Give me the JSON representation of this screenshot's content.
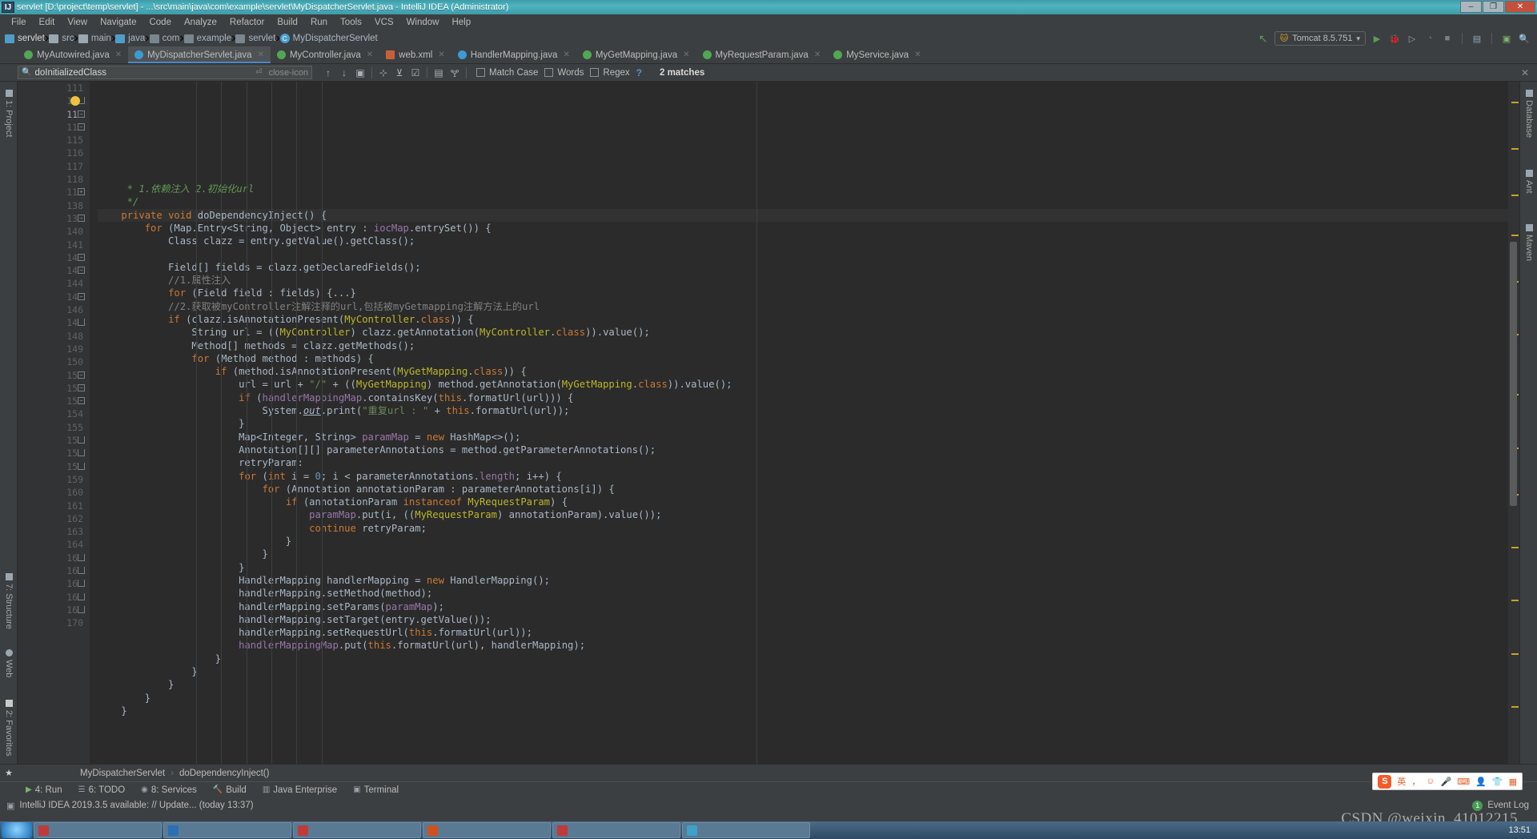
{
  "window": {
    "title": "servlet [D:\\project\\temp\\servlet] - ...\\src\\main\\java\\com\\example\\servlet\\MyDispatcherServlet.java - IntelliJ IDEA (Administrator)",
    "icon": "intellij-idea-icon",
    "minimize": "–",
    "maximize": "❐",
    "close": "✕"
  },
  "menubar": {
    "items": [
      "File",
      "Edit",
      "View",
      "Navigate",
      "Code",
      "Analyze",
      "Refactor",
      "Build",
      "Run",
      "Tools",
      "VCS",
      "Window",
      "Help"
    ]
  },
  "breadcrumb": {
    "items": [
      {
        "label": "servlet",
        "icon": "module-icon"
      },
      {
        "label": "src",
        "icon": "folder-icon"
      },
      {
        "label": "main",
        "icon": "folder-icon"
      },
      {
        "label": "java",
        "icon": "source-folder-icon"
      },
      {
        "label": "com",
        "icon": "package-icon"
      },
      {
        "label": "example",
        "icon": "package-icon"
      },
      {
        "label": "servlet",
        "icon": "package-icon"
      },
      {
        "label": "MyDispatcherServlet",
        "icon": "class-icon"
      }
    ],
    "separator": "›"
  },
  "navbar_right": {
    "back_icon": "arrow-up-left-icon",
    "run_config": {
      "label": "Tomcat 8.5.751",
      "icon": "tomcat-icon",
      "chevron": "▾"
    },
    "actions": [
      {
        "name": "run-button",
        "glyph": "▶",
        "color": "#5a9e54"
      },
      {
        "name": "debug-button",
        "glyph": "🐞",
        "color": "#5a9e54"
      },
      {
        "name": "run-with-coverage-button",
        "glyph": "▣",
        "color": "#9aa0a6"
      },
      {
        "name": "profile-button",
        "glyph": "◔",
        "color": "#6d7276"
      },
      {
        "name": "stop-button",
        "glyph": "■",
        "color": "#7c8185"
      },
      {
        "name": "project-structure-button",
        "glyph": "▤",
        "color": "#9aa0a6"
      },
      {
        "name": "terminal-button",
        "glyph": "▣",
        "color": "#9aa0a6"
      },
      {
        "name": "search-everywhere-button",
        "glyph": "🔍",
        "color": "#9aa0a6"
      }
    ]
  },
  "tabs": [
    {
      "label": "MyAutowired.java",
      "icon": "annotation-class-icon",
      "active": false,
      "close": "✕"
    },
    {
      "label": "MyDispatcherServlet.java",
      "icon": "class-icon",
      "active": true,
      "close": "✕"
    },
    {
      "label": "MyController.java",
      "icon": "annotation-class-icon",
      "active": false,
      "close": "✕"
    },
    {
      "label": "web.xml",
      "icon": "xml-file-icon",
      "active": false,
      "close": "✕"
    },
    {
      "label": "HandlerMapping.java",
      "icon": "class-icon",
      "active": false,
      "close": "✕"
    },
    {
      "label": "MyGetMapping.java",
      "icon": "annotation-class-icon",
      "active": false,
      "close": "✕"
    },
    {
      "label": "MyRequestParam.java",
      "icon": "annotation-class-icon",
      "active": false,
      "close": "✕"
    },
    {
      "label": "MyService.java",
      "icon": "annotation-class-icon",
      "active": false,
      "close": "✕"
    }
  ],
  "findbar": {
    "search_value": "doInitializedClass",
    "search_icon": "search-icon",
    "history_icon": "chevron-down-icon",
    "newline_icon": "multiline-icon",
    "clear_icon": "close-icon",
    "prev_icon": "↑",
    "next_icon": "↓",
    "select_all_icon": "▣",
    "add_cursor_icon": "+",
    "remove_cursor_icon": "−",
    "select_occurrences_icon": "☑",
    "in_selection_icon": "▤",
    "filter_icon": "▼",
    "match_case": {
      "label": "Match Case",
      "checked": false
    },
    "words": {
      "label": "Words",
      "checked": false
    },
    "regex": {
      "label": "Regex",
      "checked": false
    },
    "help": "?",
    "result": "2 matches",
    "close": "✕"
  },
  "left_tool_buttons": [
    {
      "label": "1: Project",
      "icon": "project-icon"
    },
    {
      "label": "7: Structure",
      "icon": "structure-icon"
    },
    {
      "label": "Web",
      "icon": "web-icon"
    },
    {
      "label": "2: Favorites",
      "icon": "favorites-star-icon"
    }
  ],
  "right_tool_buttons": [
    {
      "label": "Database",
      "icon": "database-icon"
    },
    {
      "label": "Ant",
      "icon": "ant-icon"
    },
    {
      "label": "Maven",
      "icon": "maven-icon"
    }
  ],
  "editor": {
    "first_line": 111,
    "caret_line": 113,
    "lines": [
      {
        "n": "111",
        "text": "     * 1.依赖注入 2.初始化url",
        "fold": "",
        "kind": "comment"
      },
      {
        "n": "112",
        "text": "     */",
        "fold": "end",
        "bulb": true,
        "kind": "comment"
      },
      {
        "n": "113",
        "text": "    private void doDependencyInject() {",
        "fold": "start",
        "current": true
      },
      {
        "n": "114",
        "text": "        for (Map.Entry<String, Object> entry : iocMap.entrySet()) {",
        "fold": "start"
      },
      {
        "n": "115",
        "text": "            Class clazz = entry.getValue().getClass();",
        "fold": ""
      },
      {
        "n": "116",
        "text": "",
        "fold": ""
      },
      {
        "n": "117",
        "text": "            Field[] fields = clazz.getDeclaredFields();",
        "fold": ""
      },
      {
        "n": "118",
        "text": "            //1.属性注入",
        "fold": ""
      },
      {
        "n": "119",
        "text": "            for (Field field : fields) {...}",
        "fold": "collapsed"
      },
      {
        "n": "138",
        "text": "            //2.获取被myController注解注释的url,包括被myGetmapping注解方法上的url",
        "fold": ""
      },
      {
        "n": "139",
        "text": "            if (clazz.isAnnotationPresent(MyController.class)) {",
        "fold": "start"
      },
      {
        "n": "140",
        "text": "                String url = ((MyController) clazz.getAnnotation(MyController.class)).value();",
        "fold": ""
      },
      {
        "n": "141",
        "text": "                Method[] methods = clazz.getMethods();",
        "fold": ""
      },
      {
        "n": "142",
        "text": "                for (Method method : methods) {",
        "fold": "start"
      },
      {
        "n": "143",
        "text": "                    if (method.isAnnotationPresent(MyGetMapping.class)) {",
        "fold": "start"
      },
      {
        "n": "144",
        "text": "                        url = url + \"/\" + ((MyGetMapping) method.getAnnotation(MyGetMapping.class)).value();",
        "fold": ""
      },
      {
        "n": "145",
        "text": "                        if (handlerMappingMap.containsKey(this.formatUrl(url))) {",
        "fold": "start"
      },
      {
        "n": "146",
        "text": "                            System.out.print(\"重复url : \" + this.formatUrl(url));",
        "fold": ""
      },
      {
        "n": "147",
        "text": "                        }",
        "fold": "end"
      },
      {
        "n": "148",
        "text": "                        Map<Integer, String> paramMap = new HashMap<>();",
        "fold": ""
      },
      {
        "n": "149",
        "text": "                        Annotation[][] parameterAnnotations = method.getParameterAnnotations();",
        "fold": ""
      },
      {
        "n": "150",
        "text": "                        retryParam:",
        "fold": ""
      },
      {
        "n": "151",
        "text": "                        for (int i = 0; i < parameterAnnotations.length; i++) {",
        "fold": "start"
      },
      {
        "n": "152",
        "text": "                            for (Annotation annotationParam : parameterAnnotations[i]) {",
        "fold": "start"
      },
      {
        "n": "153",
        "text": "                                if (annotationParam instanceof MyRequestParam) {",
        "fold": "start"
      },
      {
        "n": "154",
        "text": "                                    paramMap.put(i, ((MyRequestParam) annotationParam).value());",
        "fold": ""
      },
      {
        "n": "155",
        "text": "                                    continue retryParam;",
        "fold": ""
      },
      {
        "n": "156",
        "text": "                                }",
        "fold": "end"
      },
      {
        "n": "157",
        "text": "                            }",
        "fold": "end"
      },
      {
        "n": "158",
        "text": "                        }",
        "fold": "end"
      },
      {
        "n": "159",
        "text": "                        HandlerMapping handlerMapping = new HandlerMapping();",
        "fold": ""
      },
      {
        "n": "160",
        "text": "                        handlerMapping.setMethod(method);",
        "fold": ""
      },
      {
        "n": "161",
        "text": "                        handlerMapping.setParams(paramMap);",
        "fold": ""
      },
      {
        "n": "162",
        "text": "                        handlerMapping.setTarget(entry.getValue());",
        "fold": ""
      },
      {
        "n": "163",
        "text": "                        handlerMapping.setRequestUrl(this.formatUrl(url));",
        "fold": ""
      },
      {
        "n": "164",
        "text": "                        handlerMappingMap.put(this.formatUrl(url), handlerMapping);",
        "fold": ""
      },
      {
        "n": "165",
        "text": "                    }",
        "fold": "end"
      },
      {
        "n": "166",
        "text": "                }",
        "fold": "end"
      },
      {
        "n": "167",
        "text": "            }",
        "fold": "end"
      },
      {
        "n": "168",
        "text": "        }",
        "fold": "end"
      },
      {
        "n": "169",
        "text": "    }",
        "fold": "end"
      },
      {
        "n": "170",
        "text": "",
        "fold": ""
      }
    ]
  },
  "bottom_breadcrumb": {
    "star_icon": "bookmark-star-icon",
    "items": [
      "MyDispatcherServlet",
      "doDependencyInject()"
    ],
    "separator": "›"
  },
  "tool_windows": [
    {
      "label": "4: Run",
      "icon": "run-icon"
    },
    {
      "label": "6: TODO",
      "icon": "todo-list-icon"
    },
    {
      "label": "8: Services",
      "icon": "services-icon"
    },
    {
      "label": "Build",
      "icon": "build-hammer-icon"
    },
    {
      "label": "Java Enterprise",
      "icon": "java-enterprise-icon"
    },
    {
      "label": "Terminal",
      "icon": "terminal-icon"
    }
  ],
  "statusbar": {
    "icon": "notification-icon",
    "message": "IntelliJ IDEA 2019.3.5 available: // Update... (today 13:37)",
    "event_log": {
      "label": "Event Log",
      "count": "1"
    }
  },
  "watermark": "CSDN @weixin_41012215",
  "ime_bar": {
    "logo": "S",
    "items": [
      "英",
      "，",
      "☺",
      "🎤",
      "⌨",
      "👤",
      "👕",
      "▦"
    ]
  },
  "taskbar": {
    "clock": "13:51",
    "items": [
      "",
      "",
      "",
      "",
      "",
      "",
      ""
    ]
  },
  "colors": {
    "accent": "#4a88c7",
    "title_bar": "#46a8b5",
    "editor_bg": "#2b2b2b",
    "chrome_bg": "#3c3f41",
    "keyword": "#cc7832",
    "string": "#6a8759",
    "comment": "#808080",
    "doc_comment": "#629755",
    "number": "#6897bb",
    "annotation": "#bbb529",
    "method": "#ffc66d",
    "field": "#9876aa",
    "text": "#a9b7c6"
  }
}
